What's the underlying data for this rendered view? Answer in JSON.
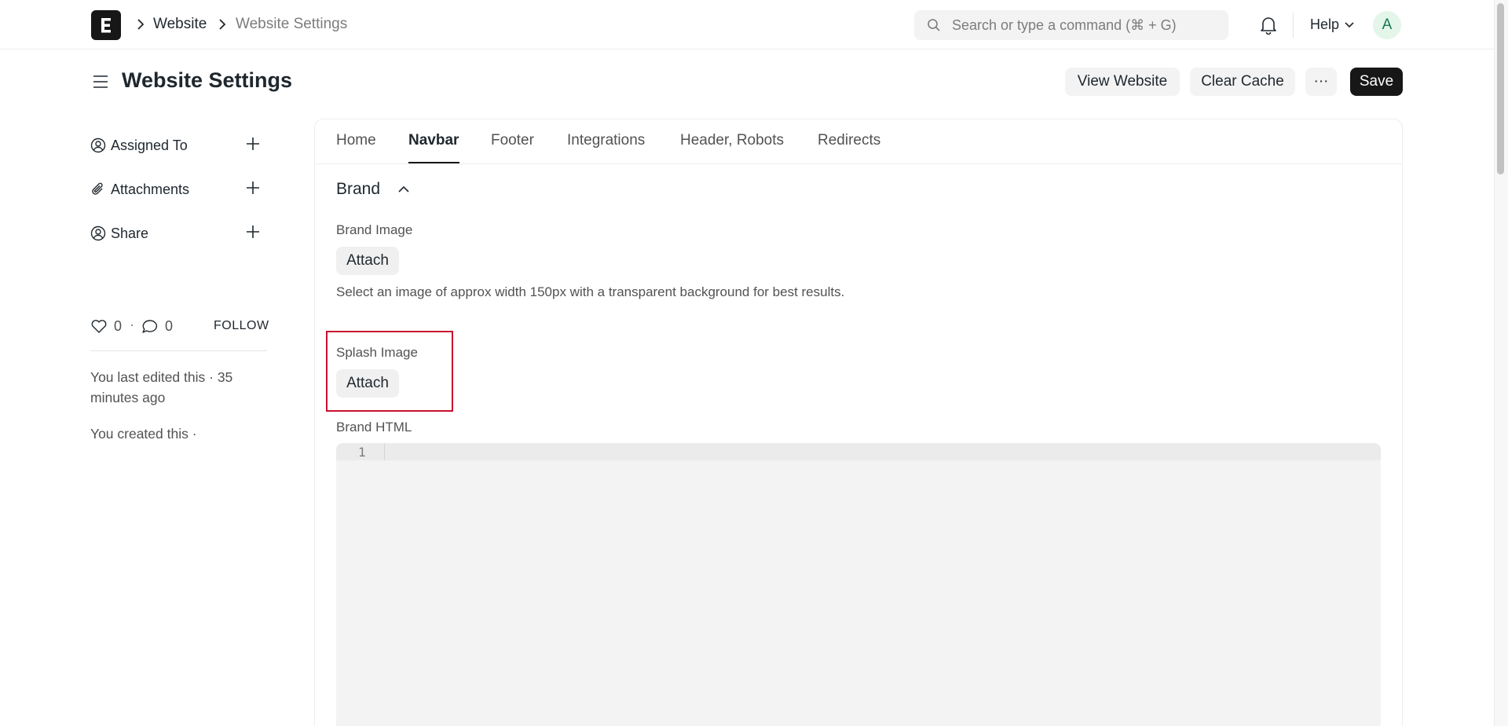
{
  "nav": {
    "breadcrumbs": [
      "Website",
      "Website Settings"
    ],
    "search_placeholder": "Search or type a command (⌘ + G)",
    "help_label": "Help",
    "avatar_initial": "A"
  },
  "header": {
    "title": "Website Settings",
    "buttons": {
      "view_website": "View Website",
      "clear_cache": "Clear Cache",
      "more": "···",
      "save": "Save"
    }
  },
  "sidebar": {
    "items": [
      {
        "label": "Assigned To",
        "icon": "assign-user-icon"
      },
      {
        "label": "Attachments",
        "icon": "paperclip-icon"
      },
      {
        "label": "Share",
        "icon": "share-user-icon"
      }
    ],
    "likes_count": "0",
    "comments_count": "0",
    "separator": "·",
    "follow_label": "FOLLOW",
    "last_edited": "You last edited this · 35 minutes ago",
    "created": "You created this ·"
  },
  "tabs": [
    "Home",
    "Navbar",
    "Footer",
    "Integrations",
    "Header, Robots",
    "Redirects"
  ],
  "active_tab": "Navbar",
  "section": {
    "title": "Brand",
    "fields": {
      "brand_image_label": "Brand Image",
      "brand_image_button": "Attach",
      "brand_image_description": "Select an image of approx width 150px with a transparent background for best results.",
      "splash_image_label": "Splash Image",
      "splash_image_button": "Attach",
      "brand_html_label": "Brand HTML",
      "editor_line_number": "1"
    }
  },
  "colors": {
    "primary_button": "#171717",
    "highlight_border": "#c8102e",
    "avatar_bg": "#e4f5e9",
    "avatar_text": "#16794c"
  }
}
